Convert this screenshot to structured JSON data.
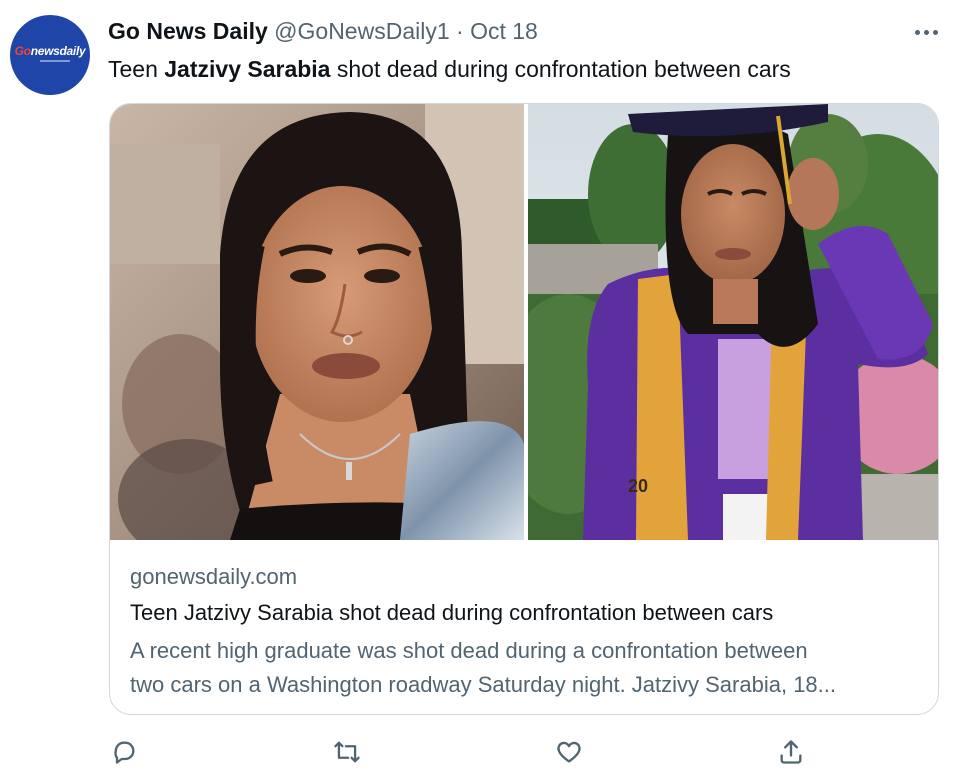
{
  "author": {
    "display_name": "Go News Daily",
    "handle": "@GoNewsDaily1",
    "separator": "·",
    "date": "Oct 18",
    "avatar_logo_go": "Go",
    "avatar_logo_rest": "newsdaily"
  },
  "tweet": {
    "text_before": "Teen ",
    "text_bold": "Jatzivy Sarabia",
    "text_after": " shot dead during confrontation between cars"
  },
  "card": {
    "domain": "gonewsdaily.com",
    "title": "Teen Jatzivy Sarabia shot dead during confrontation between cars",
    "description_line1": "A recent high graduate was shot dead during a confrontation between",
    "description_line2": "two cars on a Washington roadway Saturday night. Jatzivy Sarabia, 18...",
    "photo_right_stole_text": "20"
  },
  "actions": {
    "reply_icon": "reply-icon",
    "retweet_icon": "retweet-icon",
    "like_icon": "like-icon",
    "share_icon": "share-icon"
  },
  "colors": {
    "avatar_bg": "#1f45a8",
    "secondary_text": "#536471",
    "primary_text": "#0f1419",
    "border": "#cfd9de",
    "gown_purple": "#5b2fa0",
    "stole_gold": "#e2a43a"
  }
}
